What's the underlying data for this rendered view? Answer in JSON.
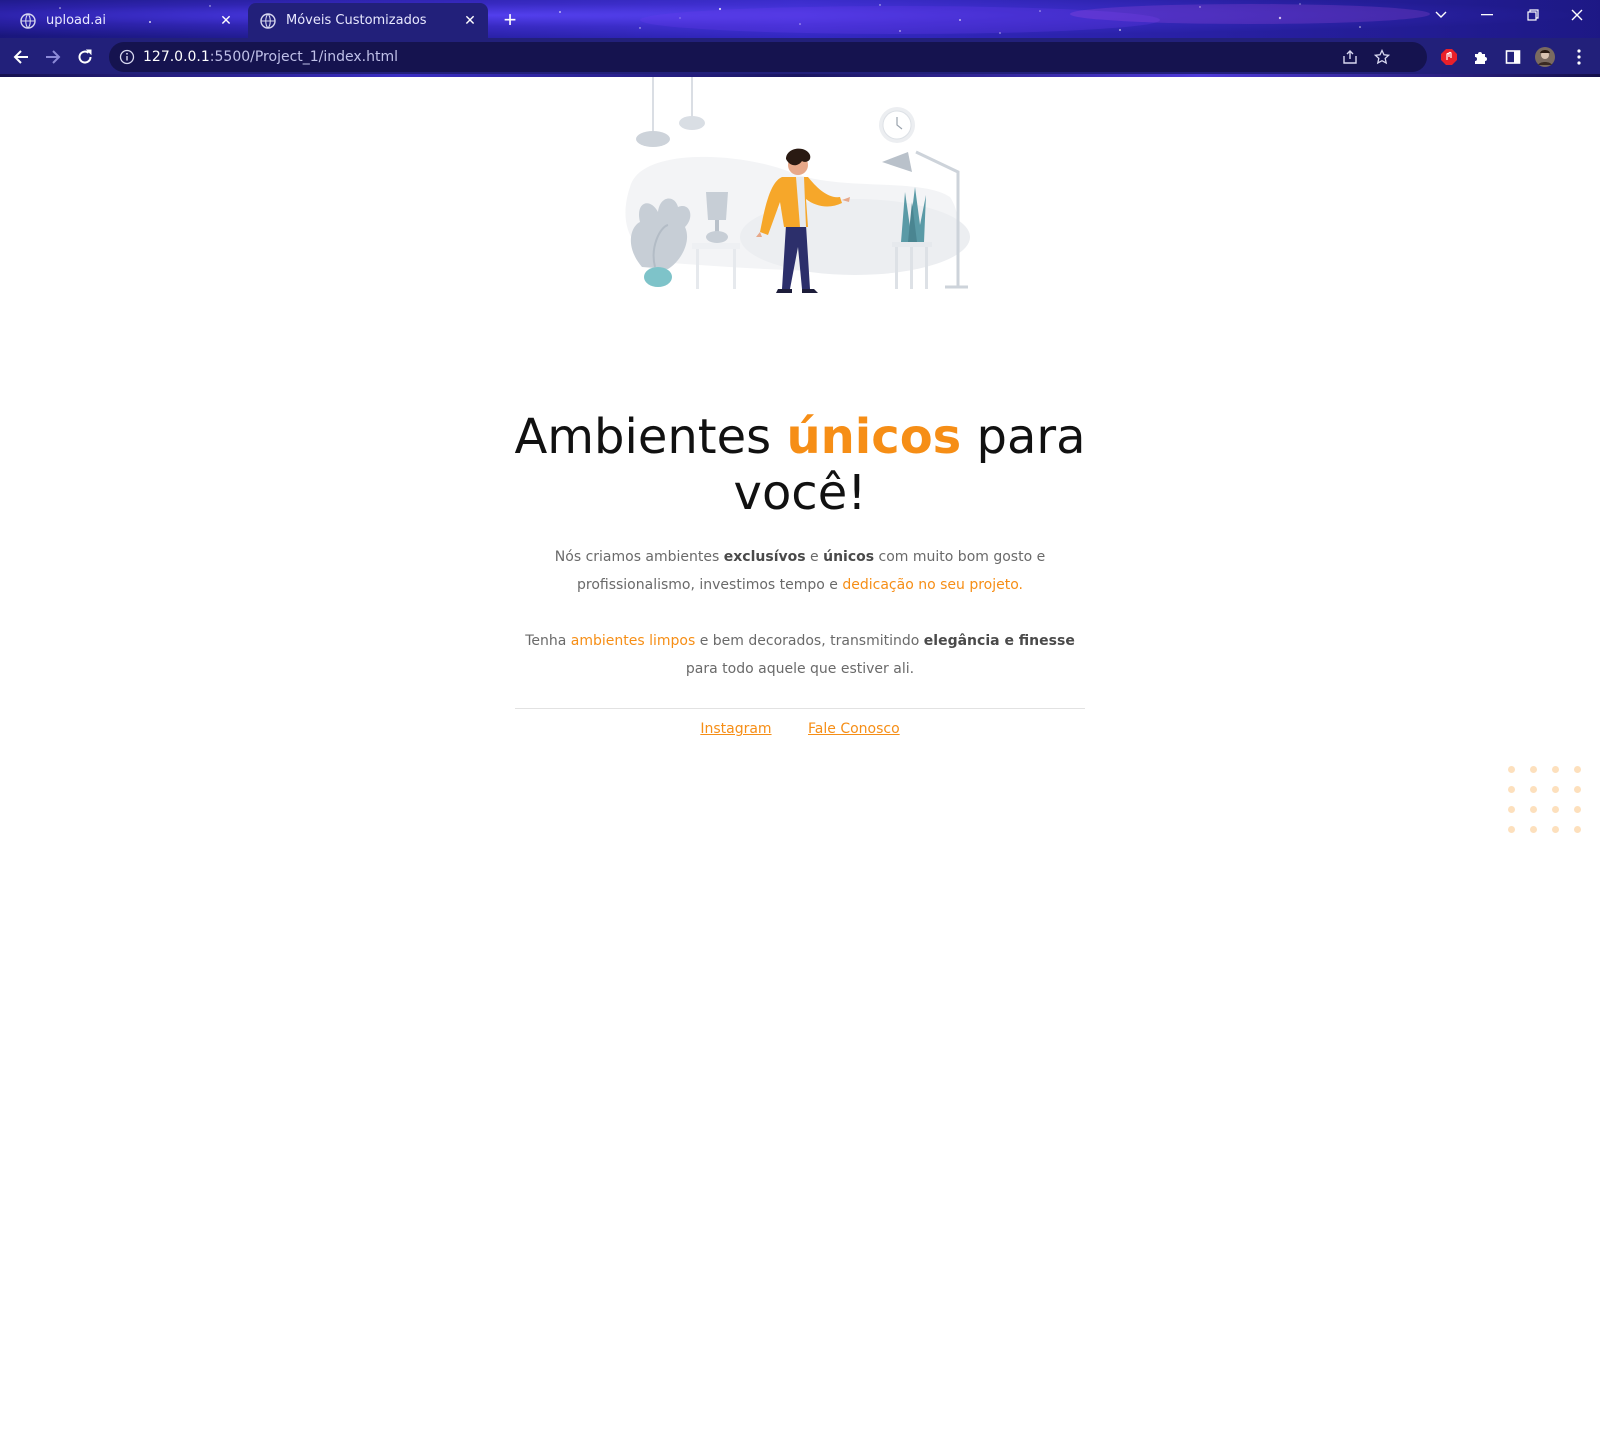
{
  "browser": {
    "tabs": [
      {
        "label": "upload.ai",
        "active": false
      },
      {
        "label": "Móveis Customizados",
        "active": true
      }
    ],
    "url_host": "127.0.0.1",
    "url_rest": ":5500/Project_1/index.html"
  },
  "hero": {
    "title_before": "Ambientes",
    "title_accent": "únicos",
    "title_after": "para você!",
    "accent_color": "#f68e16"
  },
  "intro": {
    "p1_a": "Nós criamos ambientes",
    "p1_b": "exclusívos",
    "p1_c": "e",
    "p1_d": "únicos",
    "p1_e": "com muito bom gosto e profissionalismo, investimos tempo e",
    "p1_f": "dedicação no seu projeto.",
    "p2_a": "Tenha",
    "p2_b": "ambientes limpos",
    "p2_c": "e bem decorados, transmitindo",
    "p2_d": "elegância e finesse",
    "p2_e": "para todo aquele que estiver ali."
  },
  "footer_links": {
    "instagram": "Instagram",
    "contact": "Fale Conosco"
  }
}
